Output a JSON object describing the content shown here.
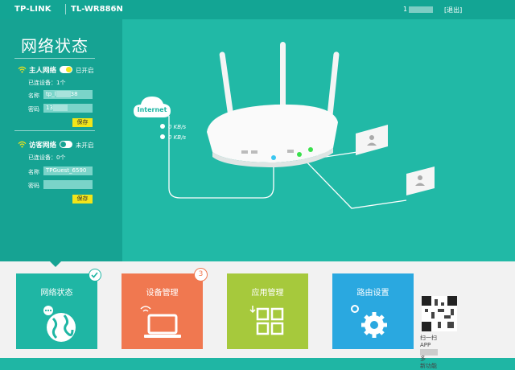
{
  "header": {
    "brand": "TP-LINK",
    "model": "TL-WR886N",
    "user": "1",
    "logout": "[退出]"
  },
  "page_title": "网络状态",
  "host_network": {
    "title": "主人网络",
    "switch_label": "已开启",
    "connected": "已连设备：1个",
    "name_label": "名称",
    "name_value": "tp_l",
    "name_value_tail": "38",
    "password_label": "密码",
    "password_value": "13",
    "save_label": "保存"
  },
  "guest_network": {
    "title": "访客网络",
    "switch_label": "未开启",
    "connected": "已连设备：0个",
    "name_label": "名称",
    "name_value": "TPGuest_6590",
    "password_label": "密码",
    "password_value": "",
    "save_label": "保存"
  },
  "diagram": {
    "internet_label": "Internet",
    "upload_speed": "0 KB/s",
    "download_speed": "0 KB/s"
  },
  "tiles": [
    {
      "label": "网络状态",
      "color": "#1fb6a4",
      "icon": "globe-icon"
    },
    {
      "label": "设备管理",
      "color": "#f07850",
      "icon": "laptop-icon",
      "badge": "3"
    },
    {
      "label": "应用管理",
      "color": "#a6c93c",
      "icon": "apps-grid-icon"
    },
    {
      "label": "路由设置",
      "color": "#2aa8e0",
      "icon": "gear-icon"
    }
  ],
  "qr": {
    "line1": "扫一扫",
    "line2": "APP",
    "line2_tail": "多",
    "line3": "新功能"
  }
}
